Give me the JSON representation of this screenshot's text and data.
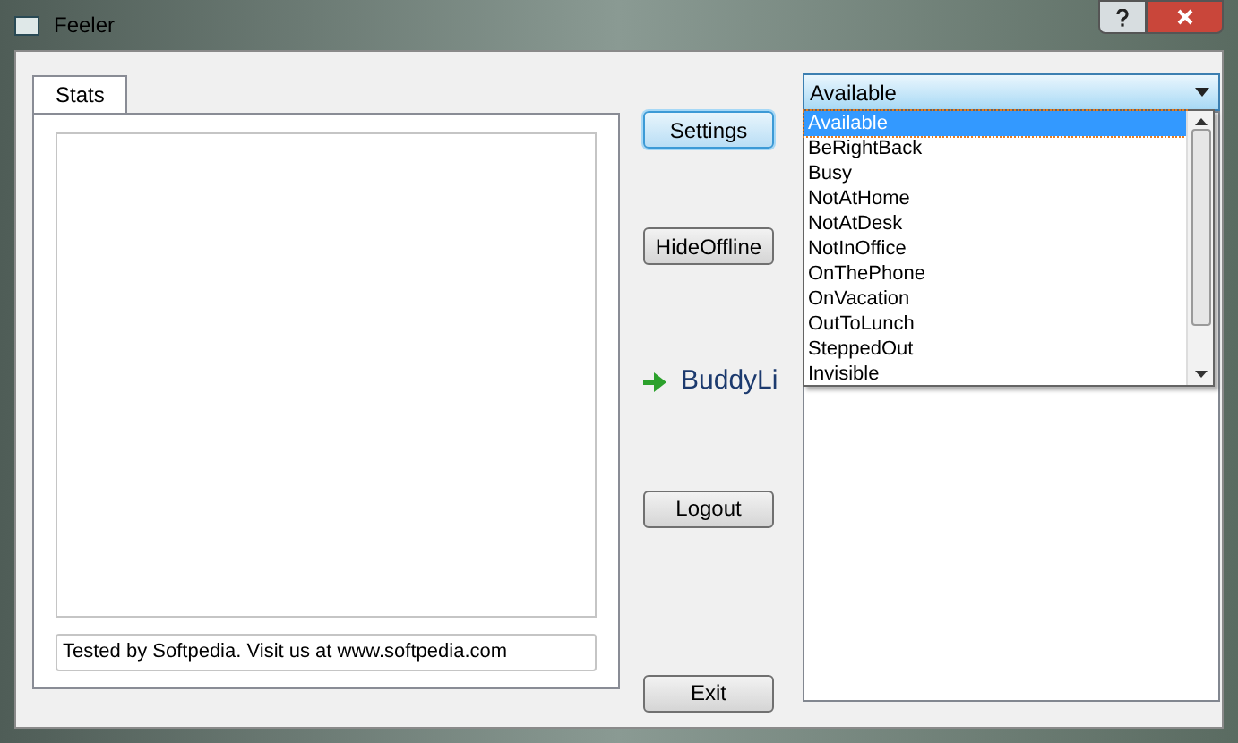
{
  "window": {
    "title": "Feeler"
  },
  "tabs": [
    {
      "label": "Stats",
      "selected": true
    }
  ],
  "status_field": {
    "value": "Tested by Softpedia. Visit us at www.softpedia.com"
  },
  "buttons": [
    {
      "label": "Settings",
      "focused": true
    },
    {
      "label": "HideOffline",
      "focused": false
    }
  ],
  "buddy_label": "BuddyLi",
  "bottom_buttons": [
    {
      "label": "Logout"
    },
    {
      "label": "Exit"
    }
  ],
  "status_combo": {
    "value": "Available",
    "expanded": true,
    "options": [
      {
        "label": "Available",
        "selected": true
      },
      {
        "label": "BeRightBack",
        "selected": false
      },
      {
        "label": "Busy",
        "selected": false
      },
      {
        "label": "NotAtHome",
        "selected": false
      },
      {
        "label": "NotAtDesk",
        "selected": false
      },
      {
        "label": "NotInOffice",
        "selected": false
      },
      {
        "label": "OnThePhone",
        "selected": false
      },
      {
        "label": "OnVacation",
        "selected": false
      },
      {
        "label": "OutToLunch",
        "selected": false
      },
      {
        "label": "SteppedOut",
        "selected": false
      },
      {
        "label": "Invisible",
        "selected": false
      }
    ]
  }
}
